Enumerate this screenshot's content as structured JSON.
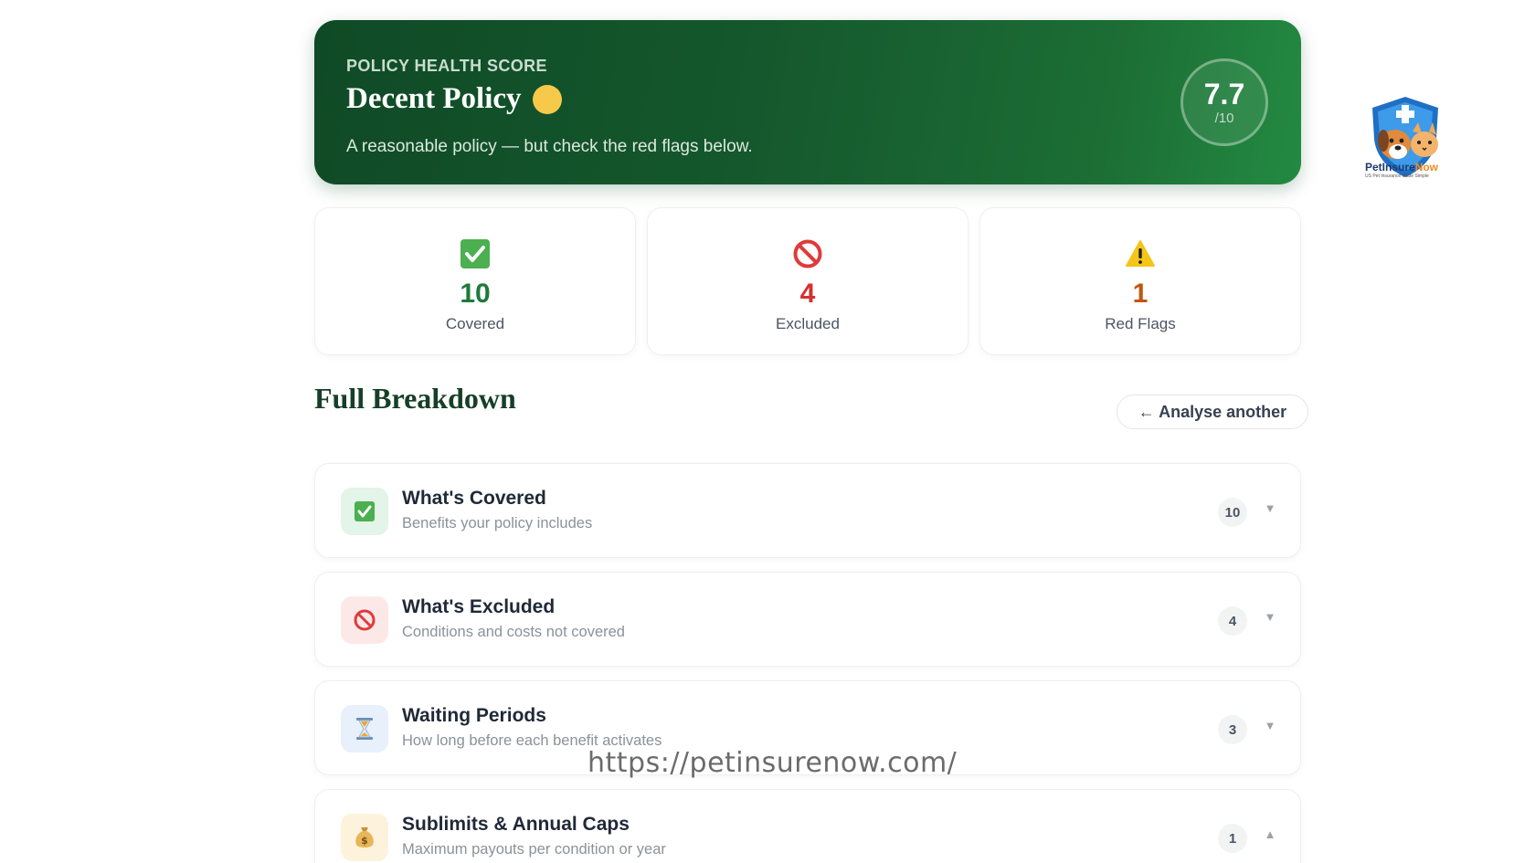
{
  "hero": {
    "eyebrow": "POLICY HEALTH SCORE",
    "title": "Decent Policy",
    "subtitle": "A reasonable policy — but check the red flags below.",
    "score": "7.7",
    "score_max": "/10",
    "status_color": "#f7c94b"
  },
  "logo": {
    "name_part1": "PetInsure",
    "name_part2": "Now",
    "tagline": "US Pet Insurance Made Simple",
    "icon": "shield-pets-logo"
  },
  "stats": [
    {
      "icon": "check-icon",
      "value": "10",
      "label": "Covered",
      "color": "#1f7a3a"
    },
    {
      "icon": "prohibited-icon",
      "value": "4",
      "label": "Excluded",
      "color": "#d62f2f"
    },
    {
      "icon": "warning-icon",
      "value": "1",
      "label": "Red Flags",
      "color": "#c0560f"
    }
  ],
  "breakdown": {
    "title": "Full Breakdown",
    "analyse_button": "← Analyse another",
    "rows": [
      {
        "icon": "check-icon",
        "title": "What's Covered",
        "subtitle": "Benefits your policy includes",
        "count": "10",
        "expanded": false
      },
      {
        "icon": "prohibited-icon",
        "title": "What's Excluded",
        "subtitle": "Conditions and costs not covered",
        "count": "4",
        "expanded": false
      },
      {
        "icon": "hourglass-icon",
        "title": "Waiting Periods",
        "subtitle": "How long before each benefit activates",
        "count": "3",
        "expanded": false
      },
      {
        "icon": "money-bag-icon",
        "title": "Sublimits & Annual Caps",
        "subtitle": "Maximum payouts per condition or year",
        "count": "1",
        "expanded": true
      }
    ]
  },
  "watermark": "https://petinsurenow.com/",
  "colors": {
    "hero_dark": "#0f4a26",
    "hero_light": "#238a42",
    "heading": "#163f27"
  }
}
